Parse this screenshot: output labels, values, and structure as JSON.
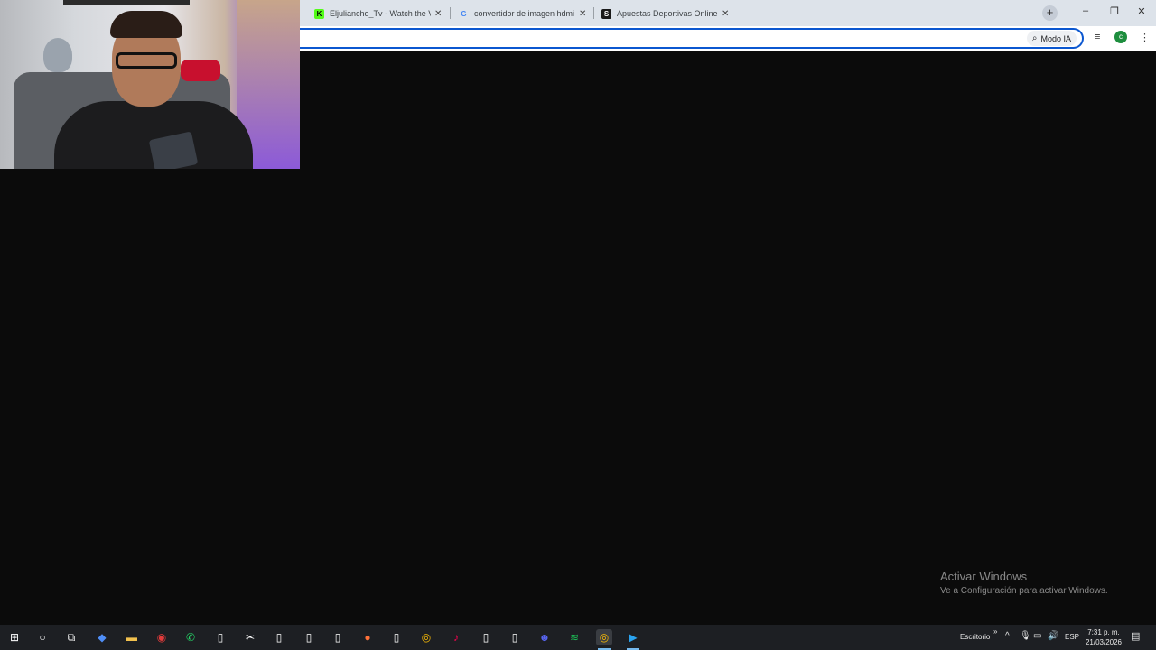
{
  "browser": {
    "tabs": [
      {
        "title": "Eljuliancho_Tv - Watch the VOD",
        "favicon": "kick-logo-icon",
        "favicon_color": "#53fc18"
      },
      {
        "title": "convertidor de imagen hdmi a",
        "favicon": "google-g-icon",
        "favicon_color": "#4285f4"
      },
      {
        "title": "Apuestas Deportivas Online - C",
        "favicon": "s-logo-icon",
        "favicon_color": "#1a1a1a"
      }
    ],
    "new_tab_symbol": "+",
    "window_controls": {
      "minimize": "–",
      "restore": "❐",
      "close": "✕"
    },
    "modo_ia_label": "Modo IA",
    "profile_initial": "c",
    "accent_color": "#0b57d0"
  },
  "watermark": {
    "line1": "Activar Windows",
    "line2": "Ve a Configuración para activar Windows."
  },
  "taskbar": {
    "icons": [
      {
        "name": "start-windows-icon",
        "glyph": "⊞"
      },
      {
        "name": "cortana-search-icon",
        "glyph": "○"
      },
      {
        "name": "task-view-icon",
        "glyph": "⧉"
      },
      {
        "name": "copilot-icon",
        "glyph": "◆"
      },
      {
        "name": "file-explorer-icon",
        "glyph": "▬"
      },
      {
        "name": "obs-record-icon",
        "glyph": "◉"
      },
      {
        "name": "whatsapp-icon",
        "glyph": "✆"
      },
      {
        "name": "file-icon-1",
        "glyph": "▯"
      },
      {
        "name": "capcut-icon",
        "glyph": "✂"
      },
      {
        "name": "file-icon-2",
        "glyph": "▯"
      },
      {
        "name": "file-icon-3",
        "glyph": "▯"
      },
      {
        "name": "file-icon-4",
        "glyph": "▯"
      },
      {
        "name": "firefox-icon",
        "glyph": "●"
      },
      {
        "name": "file-icon-5",
        "glyph": "▯"
      },
      {
        "name": "chrome-icon-1",
        "glyph": "◎"
      },
      {
        "name": "tiktok-icon",
        "glyph": "♪"
      },
      {
        "name": "file-icon-6",
        "glyph": "▯"
      },
      {
        "name": "file-icon-7",
        "glyph": "▯"
      },
      {
        "name": "discord-icon",
        "glyph": "☻"
      },
      {
        "name": "spotify-icon",
        "glyph": "≋"
      },
      {
        "name": "chrome-icon-2",
        "glyph": "◎"
      },
      {
        "name": "streaming-app-icon",
        "glyph": "▶"
      }
    ],
    "tray": {
      "desktop_label": "Escritorio",
      "language": "ESP",
      "time": "7:31 p. m.",
      "date": "21/03/2026"
    }
  }
}
